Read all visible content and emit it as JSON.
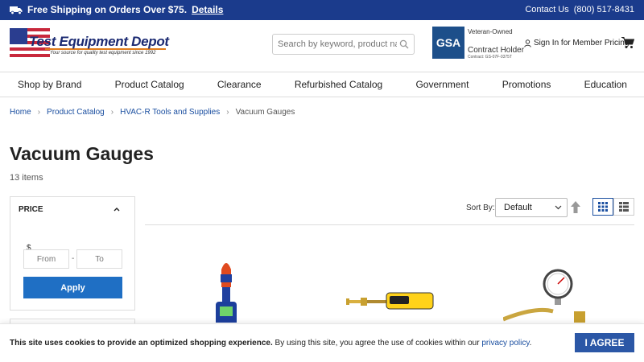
{
  "topbar": {
    "shipping_text": "Free Shipping on Orders Over $75.",
    "details_link": "Details",
    "contact_label": "Contact Us",
    "phone": "(800) 517-8431"
  },
  "header": {
    "logo_title": "Test Equipment Depot",
    "logo_tagline": "Your source for quality test equipment since 1992",
    "search_placeholder": "Search by keyword, product name",
    "gsa": {
      "badge": "GSA",
      "veteran": "Veteran-Owned",
      "holder": "Contract Holder",
      "contract": "Contract: GS-07F-0375T"
    },
    "signin": "Sign In for Member Pricing"
  },
  "nav": [
    "Shop by Brand",
    "Product Catalog",
    "Clearance",
    "Refurbished Catalog",
    "Government",
    "Promotions",
    "Education"
  ],
  "breadcrumb": {
    "home": "Home",
    "catalog": "Product Catalog",
    "category": "HVAC-R Tools and Supplies",
    "current": "Vacuum Gauges"
  },
  "page": {
    "title": "Vacuum Gauges",
    "count": "13 items"
  },
  "filter": {
    "heading": "PRICE",
    "currency": "$",
    "from_placeholder": "From",
    "to_placeholder": "To",
    "separator": "-",
    "apply": "Apply"
  },
  "sort": {
    "label": "Sort By:",
    "selected": "Default"
  },
  "cookie": {
    "bold": "This site uses cookies to provide an optimized shopping experience.",
    "text": " By using this site, you agree the use of cookies within our ",
    "link": "privacy policy",
    "end": ".",
    "button": "I AGREE"
  },
  "colors": {
    "topbar": "#1b3b8c",
    "accent": "#1f6fc4",
    "agree": "#2b57a6"
  }
}
